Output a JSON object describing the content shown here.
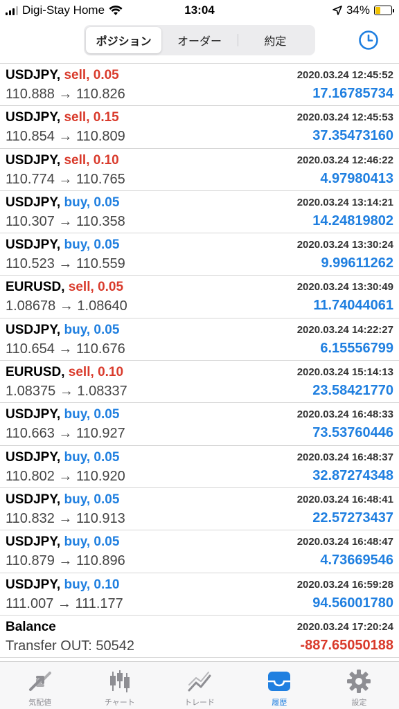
{
  "status": {
    "carrier": "Digi-Stay Home",
    "time": "13:04",
    "battery": "34%"
  },
  "segments": [
    "ポジション",
    "オーダー",
    "約定"
  ],
  "rows": [
    {
      "symbol": "USDJPY,",
      "side": "sell",
      "lot": "0.05",
      "time": "2020.03.24 12:45:52",
      "open": "110.888",
      "close": "110.826",
      "profit": "17.16785734"
    },
    {
      "symbol": "USDJPY,",
      "side": "sell",
      "lot": "0.15",
      "time": "2020.03.24 12:45:53",
      "open": "110.854",
      "close": "110.809",
      "profit": "37.35473160"
    },
    {
      "symbol": "USDJPY,",
      "side": "sell",
      "lot": "0.10",
      "time": "2020.03.24 12:46:22",
      "open": "110.774",
      "close": "110.765",
      "profit": "4.97980413"
    },
    {
      "symbol": "USDJPY,",
      "side": "buy",
      "lot": "0.05",
      "time": "2020.03.24 13:14:21",
      "open": "110.307",
      "close": "110.358",
      "profit": "14.24819802"
    },
    {
      "symbol": "USDJPY,",
      "side": "buy",
      "lot": "0.05",
      "time": "2020.03.24 13:30:24",
      "open": "110.523",
      "close": "110.559",
      "profit": "9.99611262"
    },
    {
      "symbol": "EURUSD,",
      "side": "sell",
      "lot": "0.05",
      "time": "2020.03.24 13:30:49",
      "open": "1.08678",
      "close": "1.08640",
      "profit": "11.74044061"
    },
    {
      "symbol": "USDJPY,",
      "side": "buy",
      "lot": "0.05",
      "time": "2020.03.24 14:22:27",
      "open": "110.654",
      "close": "110.676",
      "profit": "6.15556799"
    },
    {
      "symbol": "EURUSD,",
      "side": "sell",
      "lot": "0.10",
      "time": "2020.03.24 15:14:13",
      "open": "1.08375",
      "close": "1.08337",
      "profit": "23.58421770"
    },
    {
      "symbol": "USDJPY,",
      "side": "buy",
      "lot": "0.05",
      "time": "2020.03.24 16:48:33",
      "open": "110.663",
      "close": "110.927",
      "profit": "73.53760446"
    },
    {
      "symbol": "USDJPY,",
      "side": "buy",
      "lot": "0.05",
      "time": "2020.03.24 16:48:37",
      "open": "110.802",
      "close": "110.920",
      "profit": "32.87274348"
    },
    {
      "symbol": "USDJPY,",
      "side": "buy",
      "lot": "0.05",
      "time": "2020.03.24 16:48:41",
      "open": "110.832",
      "close": "110.913",
      "profit": "22.57273437"
    },
    {
      "symbol": "USDJPY,",
      "side": "buy",
      "lot": "0.05",
      "time": "2020.03.24 16:48:47",
      "open": "110.879",
      "close": "110.896",
      "profit": "4.73669546"
    },
    {
      "symbol": "USDJPY,",
      "side": "buy",
      "lot": "0.10",
      "time": "2020.03.24 16:59:28",
      "open": "111.007",
      "close": "111.177",
      "profit": "94.56001780"
    }
  ],
  "balance": {
    "label": "Balance",
    "time": "2020.03.24 17:20:24",
    "detail": "Transfer OUT: 50542",
    "amount": "-887.65050188"
  },
  "tabs": [
    "気配値",
    "チャート",
    "トレード",
    "履歴",
    "設定"
  ],
  "colors": {
    "sell": "#d93a2b",
    "buy": "#1f7fe0",
    "accent": "#1f7fe0"
  }
}
